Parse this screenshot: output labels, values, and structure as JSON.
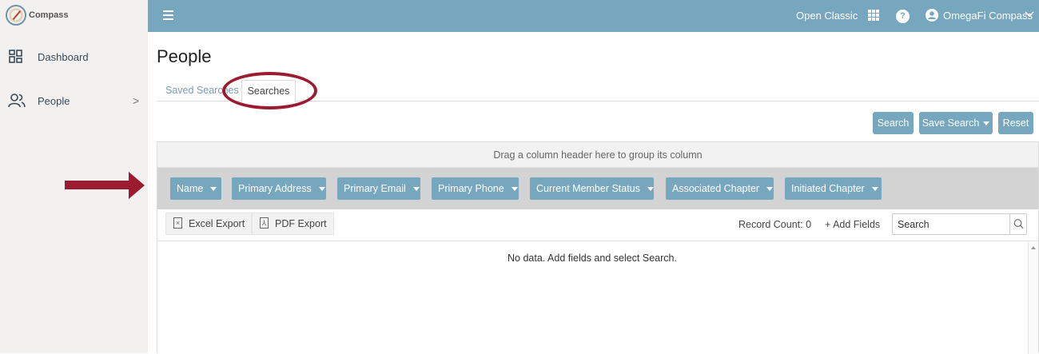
{
  "brand": {
    "name": "Compass"
  },
  "sidebar": {
    "items": [
      {
        "label": "Dashboard",
        "icon": "dashboard-icon"
      },
      {
        "label": "People",
        "icon": "people-icon",
        "chevron": ">"
      }
    ]
  },
  "topbar": {
    "open_classic": "Open Classic",
    "help": "?",
    "user_name": "OmegaFi Compass"
  },
  "page": {
    "title": "People"
  },
  "tabs": [
    {
      "label": "Saved Searches"
    },
    {
      "label": "Searches",
      "active": true
    }
  ],
  "actions": {
    "search": "Search",
    "save_search": "Save Search",
    "reset": "Reset"
  },
  "grid": {
    "group_hint": "Drag a column header here to group its column",
    "columns": [
      "Name",
      "Primary Address",
      "Primary Email",
      "Primary Phone",
      "Current Member Status",
      "Associated Chapter",
      "Initiated Chapter"
    ],
    "excel_export": "Excel Export",
    "pdf_export": "PDF Export",
    "record_count": "Record Count: 0",
    "add_fields": "+ Add Fields",
    "search_placeholder": "Search",
    "no_data": "No data. Add fields and select Search."
  },
  "colors": {
    "accent": "#77a7bf",
    "annotation": "#9b1c30",
    "sidebar_bg": "#f2f1ef"
  }
}
